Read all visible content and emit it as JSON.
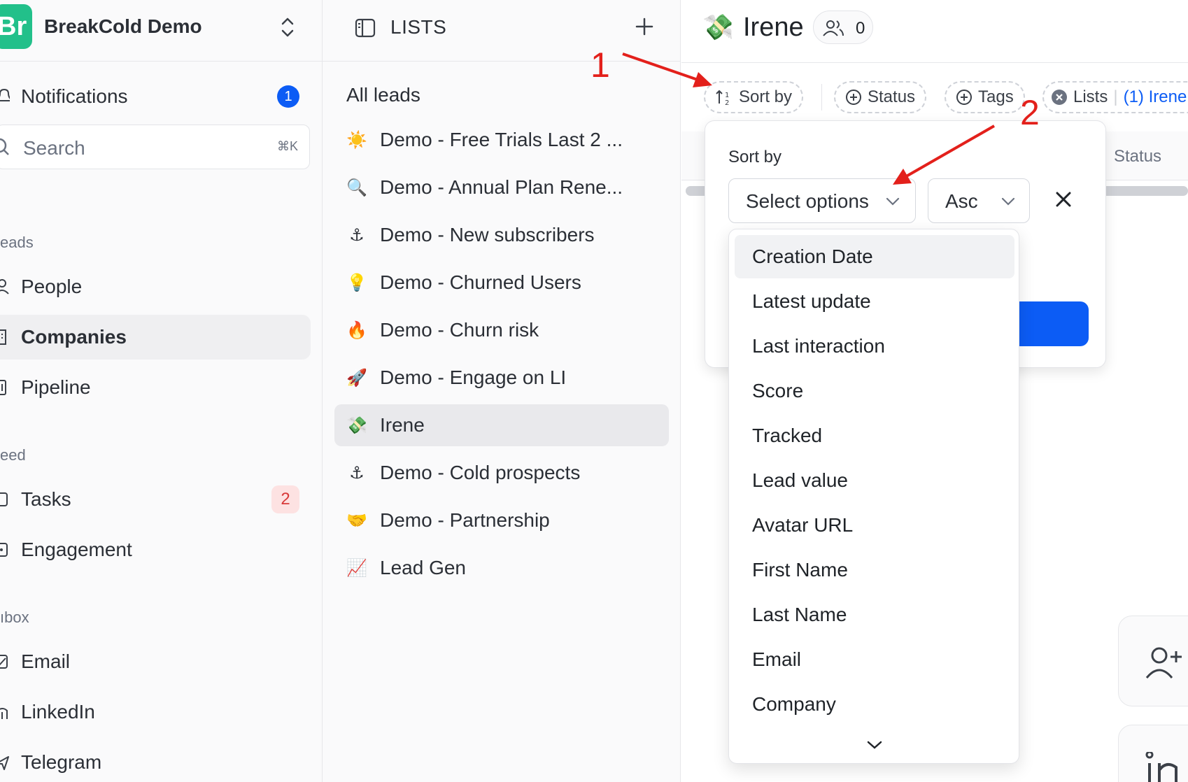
{
  "workspace": {
    "logo_text": "Br",
    "name": "BreakCold Demo"
  },
  "nav": {
    "notifications": {
      "label": "Notifications",
      "badge": "1"
    },
    "search": {
      "placeholder": "Search",
      "shortcut": "⌘K"
    },
    "section_leads": "eads",
    "people": "People",
    "companies": "Companies",
    "pipeline": "Pipeline",
    "section_feed": "eed",
    "tasks": {
      "label": "Tasks",
      "badge": "2"
    },
    "engagement": "Engagement",
    "section_inbox": "ıbox",
    "email": "Email",
    "linkedin": "LinkedIn",
    "telegram": "Telegram"
  },
  "lists": {
    "title": "LISTS",
    "all_label": "All leads",
    "items": [
      {
        "emoji": "☀️",
        "label": "Demo - Free Trials Last 2 ..."
      },
      {
        "emoji": "🔍",
        "label": "Demo - Annual Plan Rene..."
      },
      {
        "emoji": "⚓",
        "label": "Demo - New subscribers"
      },
      {
        "emoji": "💡",
        "label": "Demo - Churned Users"
      },
      {
        "emoji": "🔥",
        "label": "Demo - Churn risk"
      },
      {
        "emoji": "🚀",
        "label": "Demo - Engage on LI"
      },
      {
        "emoji": "💸",
        "label": "Irene"
      },
      {
        "emoji": "⚓",
        "label": "Demo - Cold prospects"
      },
      {
        "emoji": "🤝",
        "label": "Demo - Partnership"
      },
      {
        "emoji": "📈",
        "label": "Lead Gen"
      }
    ],
    "active": "Irene"
  },
  "main": {
    "emoji": "💸",
    "title": "Irene",
    "member_count": "0",
    "filters": {
      "sort_by": "Sort by",
      "status": "Status",
      "tags": "Tags",
      "lists": "Lists",
      "lists_value": "(1) Irene"
    },
    "column_status": "Status"
  },
  "sort_popover": {
    "label": "Sort by",
    "select_placeholder": "Select options",
    "order": "Asc",
    "options": [
      "Creation Date",
      "Latest update",
      "Last interaction",
      "Score",
      "Tracked",
      "Lead value",
      "Avatar URL",
      "First Name",
      "Last Name",
      "Email",
      "Company"
    ],
    "highlighted": "Creation Date"
  },
  "annotations": {
    "step1": "1",
    "step2": "2",
    "color": "#e3201b"
  },
  "colors": {
    "accent": "#0c5cf5",
    "logo": "#22c08a",
    "badge_red_text": "#d83a3a"
  }
}
